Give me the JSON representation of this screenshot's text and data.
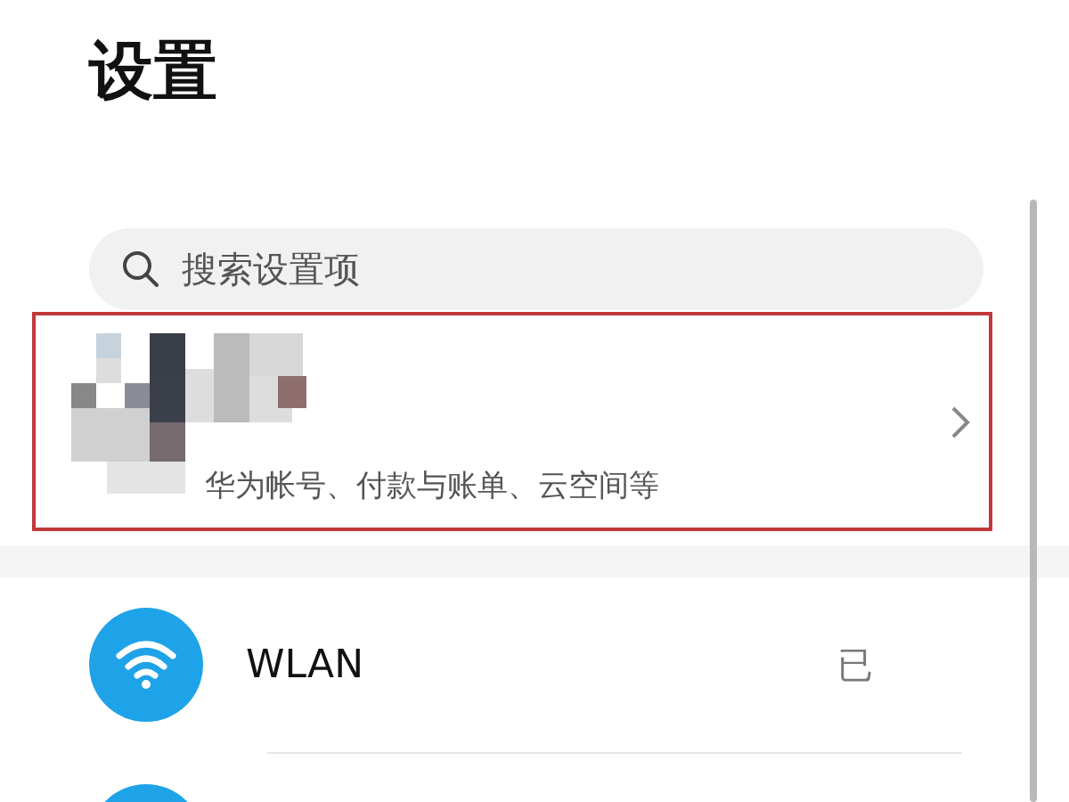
{
  "title": "设置",
  "search": {
    "placeholder": "搜索设置项"
  },
  "account": {
    "kind": "picture",
    "subtitle": "华为帐号、付款与账单、云空间等",
    "highlighted": true
  },
  "items": [
    {
      "kind": "wifi",
      "label": "WLAN",
      "value": "已"
    },
    {
      "kind": "blank"
    }
  ]
}
